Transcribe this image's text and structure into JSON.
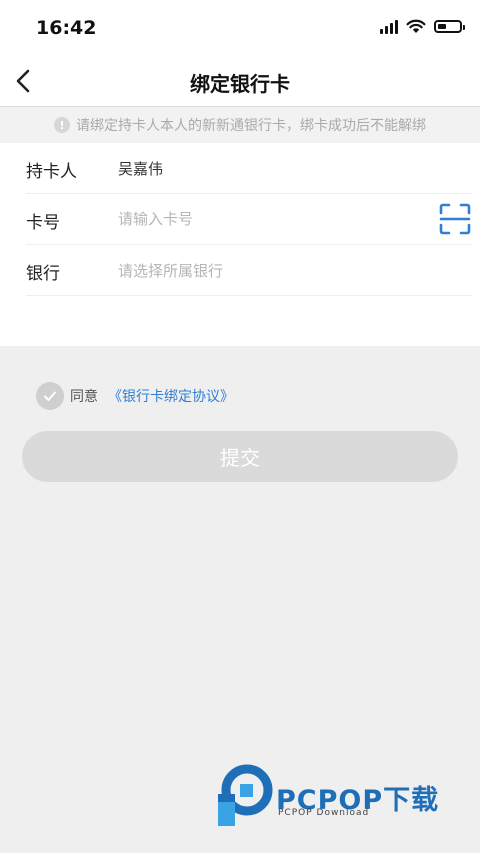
{
  "status_bar": {
    "time": "16:42"
  },
  "nav": {
    "title": "绑定银行卡"
  },
  "notice": {
    "icon": "exclamation-icon",
    "text": "请绑定持卡人本人的新新通银行卡，绑卡成功后不能解绑"
  },
  "form": {
    "holder": {
      "label": "持卡人",
      "value": "吴嘉伟"
    },
    "card_number": {
      "label": "卡号",
      "placeholder": "请输入卡号",
      "value": ""
    },
    "bank": {
      "label": "银行",
      "placeholder": "请选择所属银行"
    }
  },
  "agreement": {
    "prefix": "同意",
    "link": "《银行卡绑定协议》",
    "checked": false
  },
  "submit": {
    "label": "提交"
  },
  "watermark": {
    "name": "PCPOP下载",
    "subtitle": "PCPOP Download"
  },
  "colors": {
    "accent": "#2f7fd6",
    "disabled_button": "#dadada",
    "background": "#efefef"
  }
}
